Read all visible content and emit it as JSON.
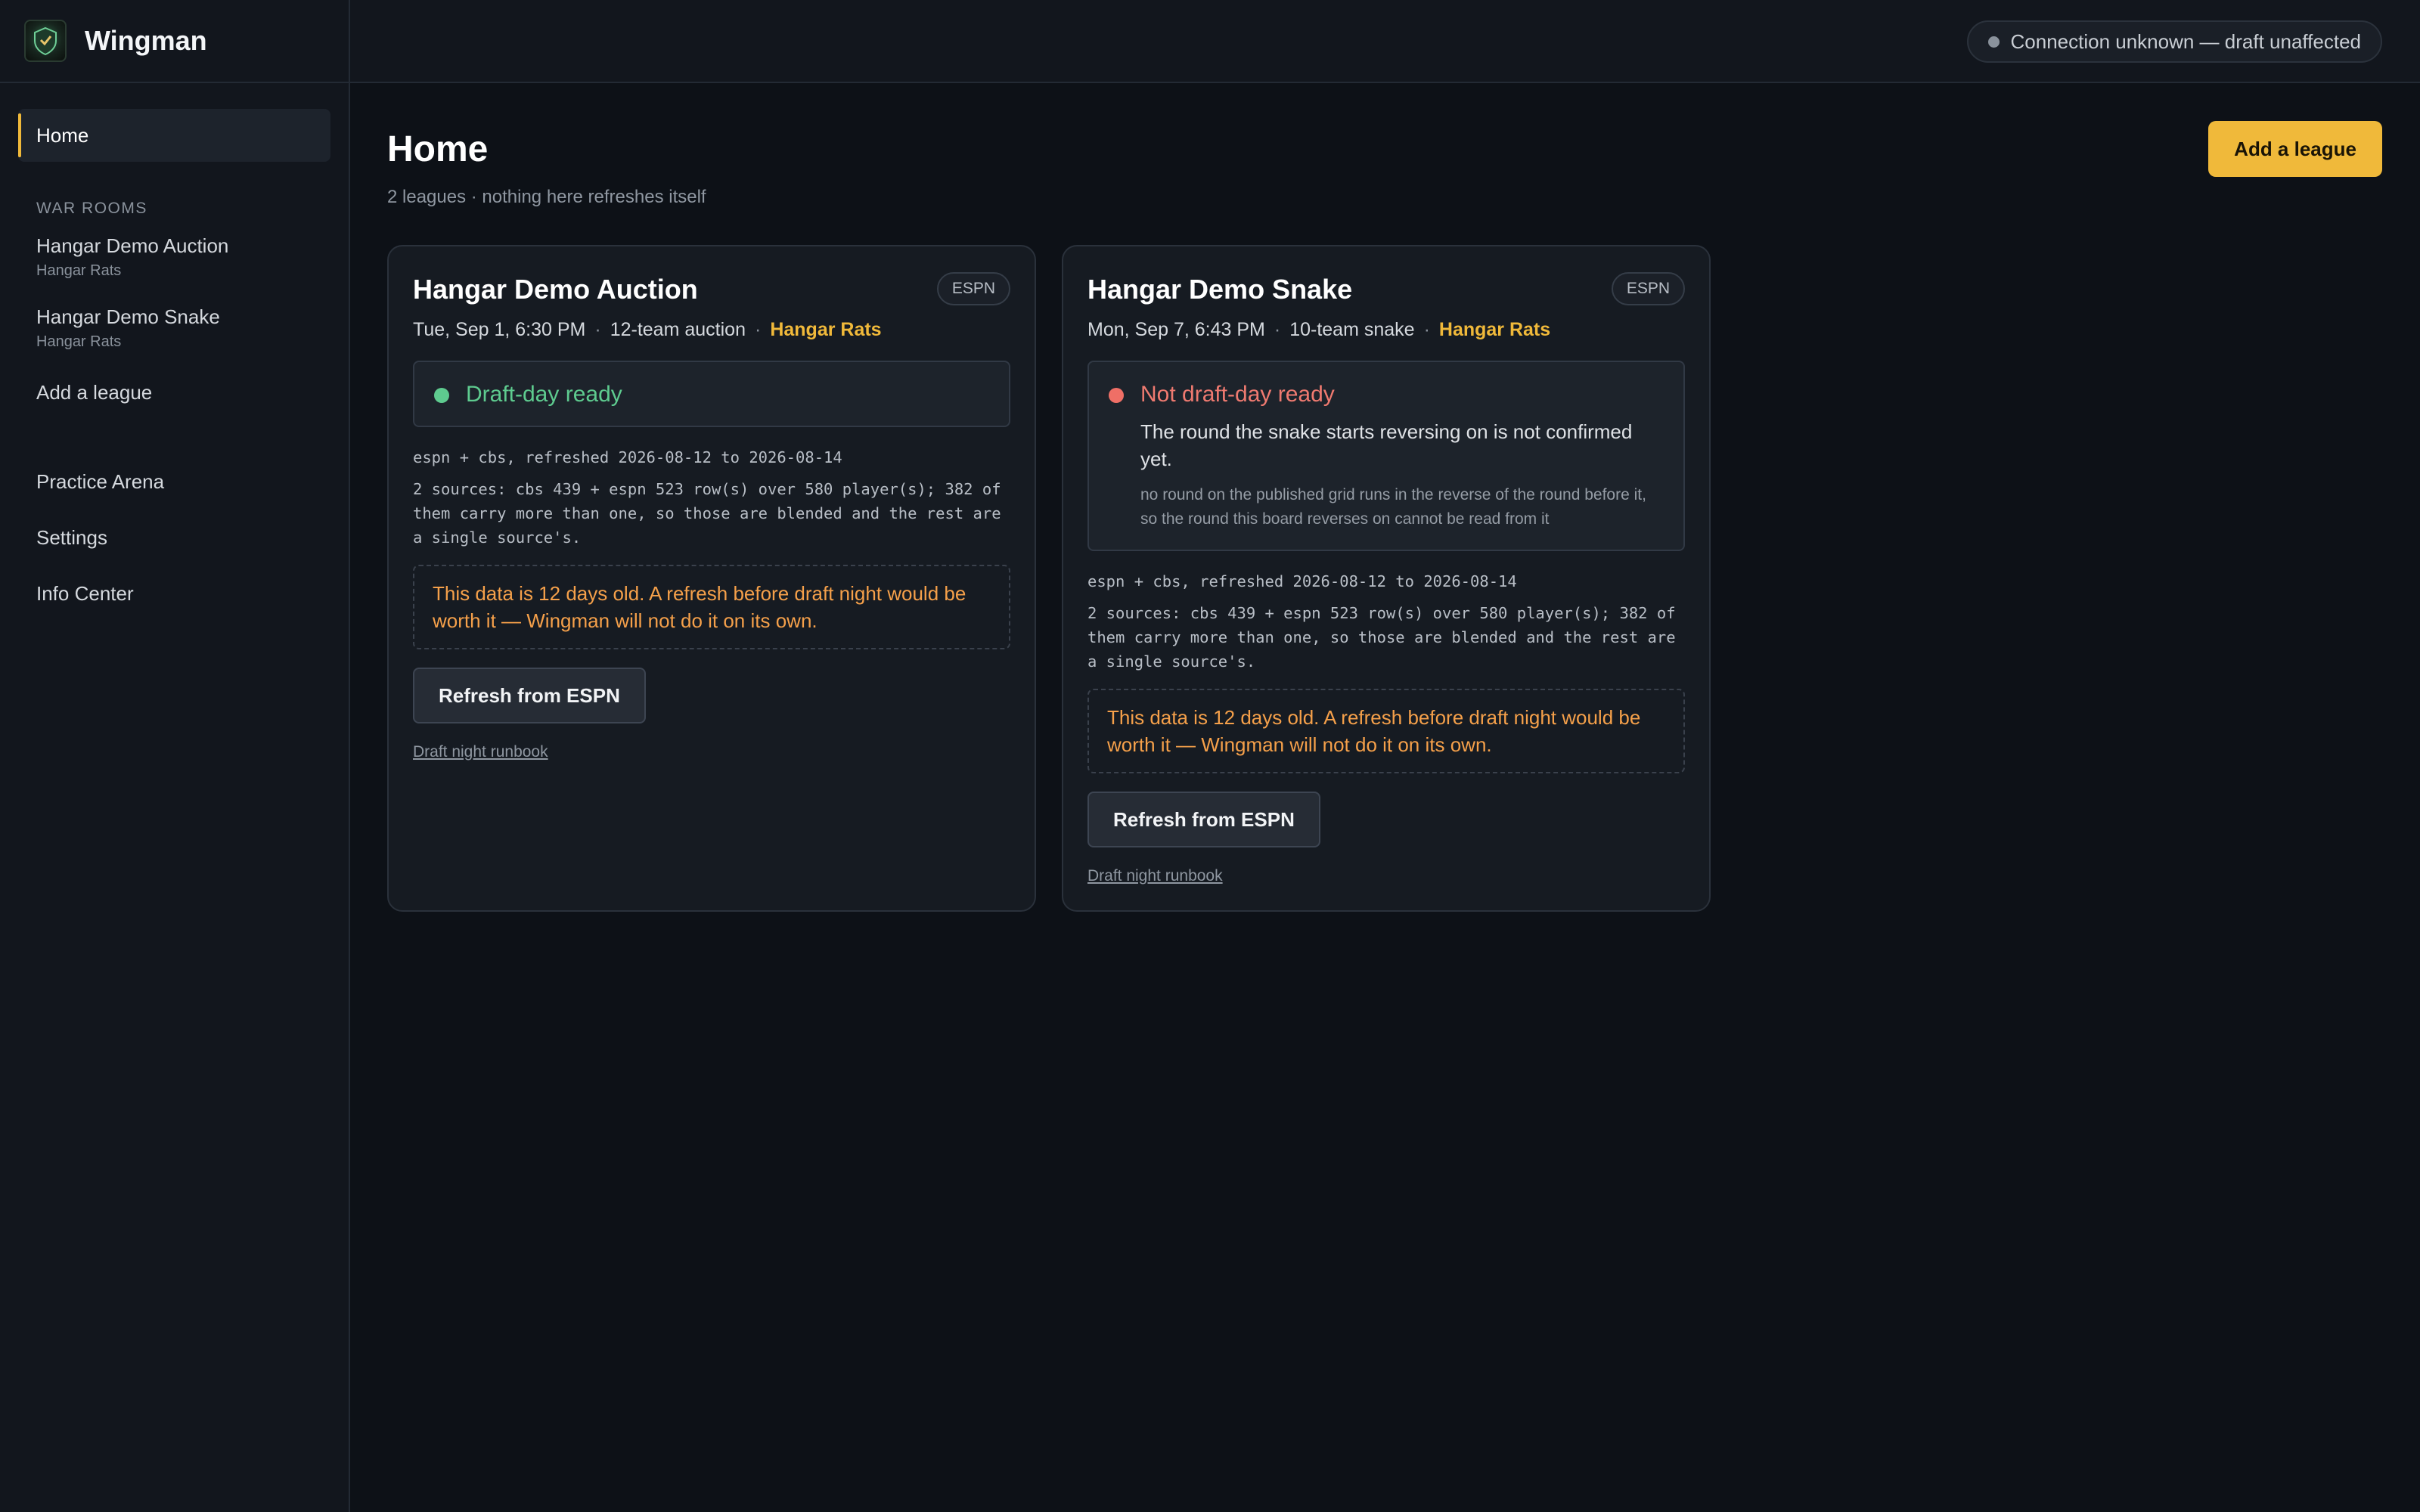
{
  "app": {
    "name": "Wingman",
    "logo": "shield-logo-icon"
  },
  "connection": {
    "label": "Connection unknown — draft unaffected",
    "dot_color": "#8a929c"
  },
  "sidebar": {
    "home_label": "Home",
    "section_label": "WAR ROOMS",
    "war_rooms": [
      {
        "title": "Hangar Demo Auction",
        "sub": "Hangar Rats"
      },
      {
        "title": "Hangar Demo Snake",
        "sub": "Hangar Rats"
      }
    ],
    "add_league_label": "Add a league",
    "items": [
      {
        "label": "Practice Arena"
      },
      {
        "label": "Settings"
      },
      {
        "label": "Info Center"
      }
    ]
  },
  "main": {
    "title": "Home",
    "subtitle": "2 leagues · nothing here refreshes itself",
    "add_league_button": "Add a league"
  },
  "cards": [
    {
      "title": "Hangar Demo Auction",
      "provider": "ESPN",
      "date": "Tue, Sep 1, 6:30 PM",
      "format": "12-team auction",
      "team": "Hangar Rats",
      "status_title": "Draft-day ready",
      "status_kind": "ok",
      "refreshed": "espn + cbs, refreshed 2026-08-12 to 2026-08-14",
      "sources": "2 sources: cbs 439 + espn 523 row(s) over 580 player(s); 382 of them carry more than one, so those are blended and the rest are a single source's.",
      "warning": "This data is 12 days old. A refresh before draft night would be worth it — Wingman will not do it on its own.",
      "refresh_button": "Refresh from ESPN",
      "runbook_link": "Draft night runbook"
    },
    {
      "title": "Hangar Demo Snake",
      "provider": "ESPN",
      "date": "Mon, Sep 7, 6:43 PM",
      "format": "10-team snake",
      "team": "Hangar Rats",
      "status_title": "Not draft-day ready",
      "status_kind": "bad",
      "status_detail": "The round the snake starts reversing on is not confirmed yet.",
      "status_note": "no round on the published grid runs in the reverse of the round before it, so the round this board reverses on cannot be read from it",
      "refreshed": "espn + cbs, refreshed 2026-08-12 to 2026-08-14",
      "sources": "2 sources: cbs 439 + espn 523 row(s) over 580 player(s); 382 of them carry more than one, so those are blended and the rest are a single source's.",
      "warning": "This data is 12 days old. A refresh before draft night would be worth it — Wingman will not do it on its own.",
      "refresh_button": "Refresh from ESPN",
      "runbook_link": "Draft night runbook"
    }
  ],
  "colors": {
    "accent": "#f0b93a",
    "ok": "#5ecb8f",
    "bad": "#ef6f66",
    "warning": "#f5a04a",
    "background": "#0d1117"
  }
}
